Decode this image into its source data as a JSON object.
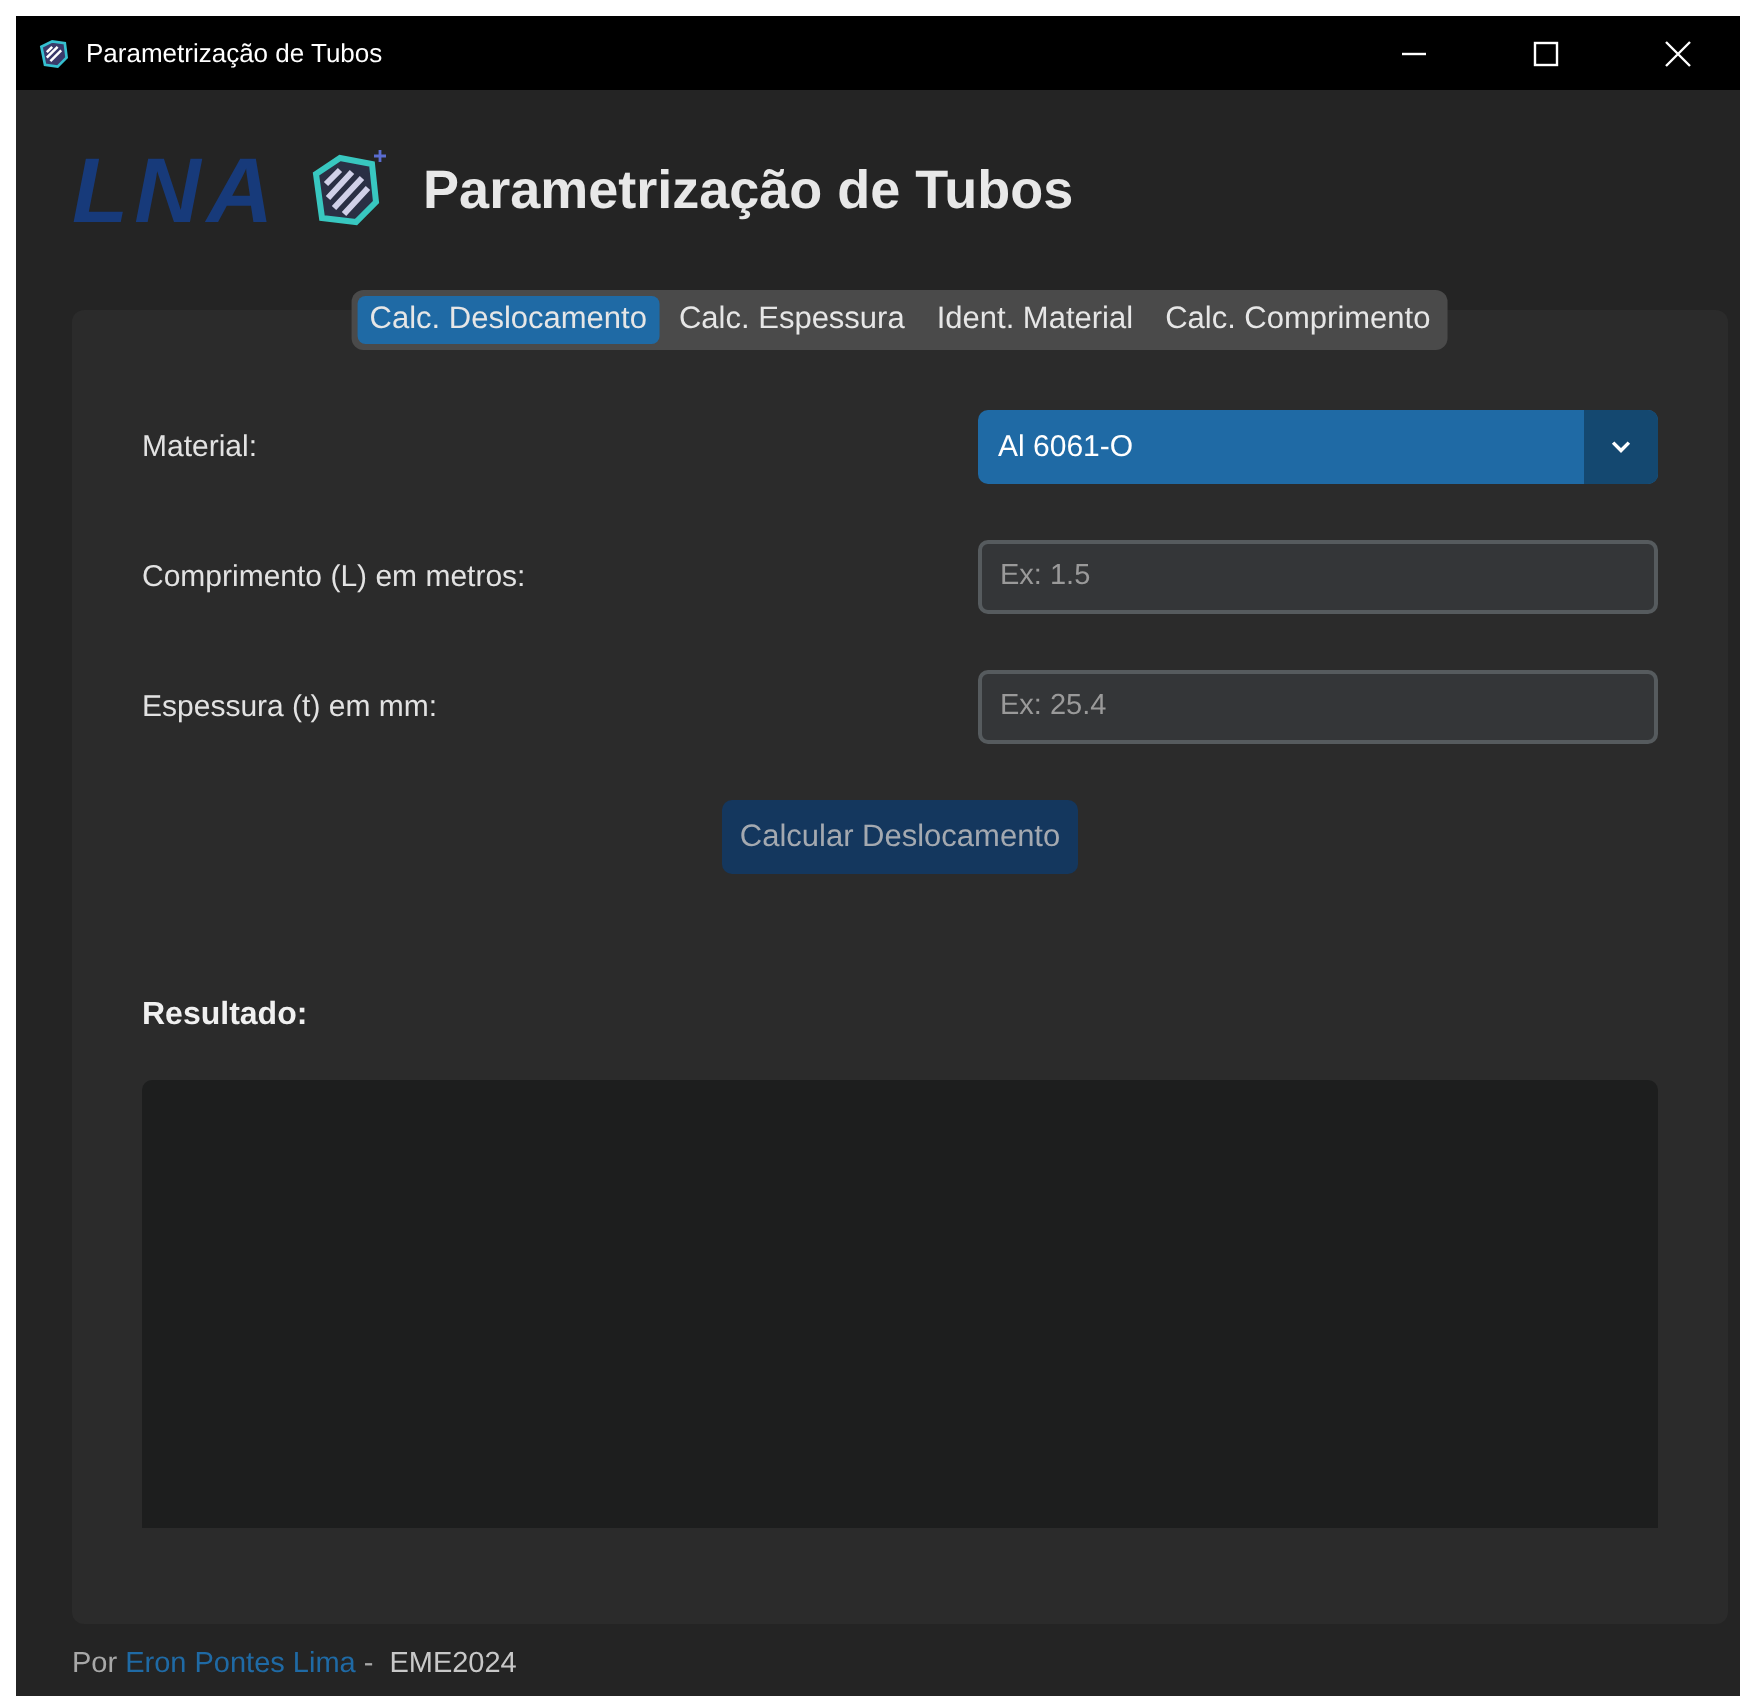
{
  "window": {
    "title": "Parametrização de Tubos"
  },
  "header": {
    "logo_text": "LNA",
    "title": "Parametrização de Tubos"
  },
  "tabs": [
    {
      "label": "Calc. Deslocamento",
      "selected": true
    },
    {
      "label": "Calc. Espessura",
      "selected": false
    },
    {
      "label": "Ident. Material",
      "selected": false
    },
    {
      "label": "Calc. Comprimento",
      "selected": false
    }
  ],
  "fields": [
    {
      "kind": "dropdown",
      "label": "Material:",
      "value": "Al 6061-O"
    },
    {
      "kind": "entry",
      "label": "Comprimento (L) em metros:",
      "placeholder": "Ex: 1.5"
    },
    {
      "kind": "entry",
      "label": "Espessura (t) em mm:",
      "placeholder": "Ex: 25.4"
    }
  ],
  "action_button": "Calcular Deslocamento",
  "result": {
    "label": "Resultado:"
  },
  "footer": {
    "prefix": "Por",
    "author": "Eron Pontes Lima",
    "separator": "-",
    "suffix": "EME2024"
  }
}
